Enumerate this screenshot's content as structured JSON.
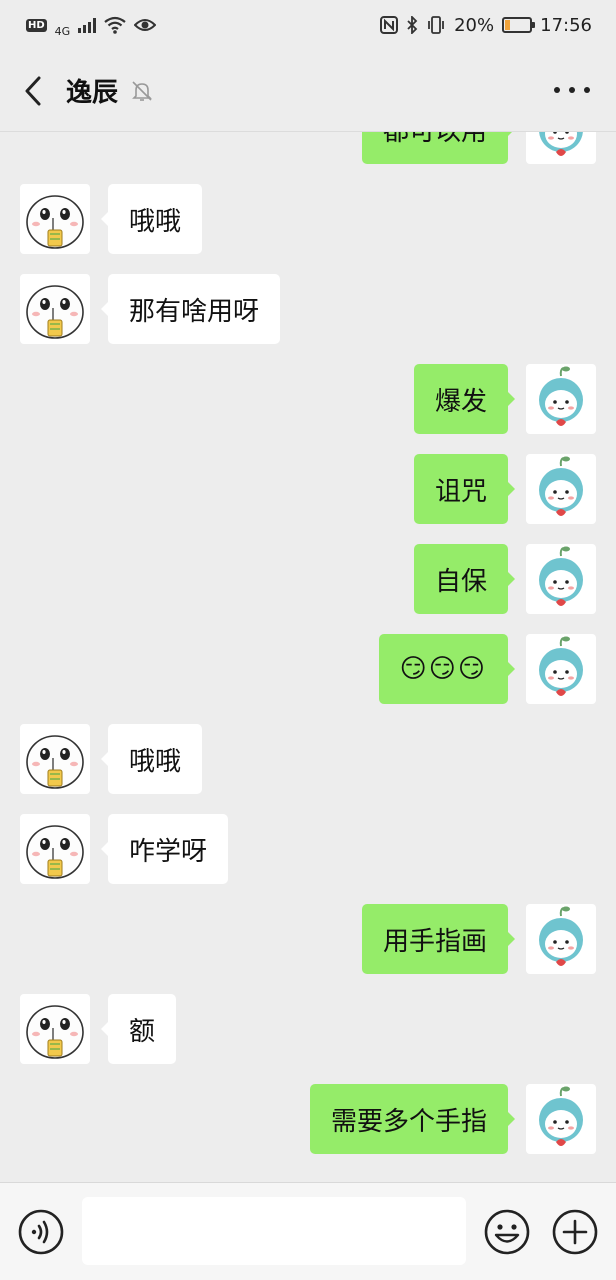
{
  "status_bar": {
    "network": "4G",
    "battery_percent": "20%",
    "battery_level": 0.2,
    "time": "17:56"
  },
  "header": {
    "title": "逸辰",
    "back_icon": "chevron-left-icon",
    "mute_icon": "bell-off-icon",
    "more_icon": "more-dots-icon"
  },
  "messages": [
    {
      "side": "right",
      "text": "都可以用",
      "avatar": "teal-cartoon-avatar"
    },
    {
      "side": "left",
      "text": "哦哦",
      "avatar": "white-cartoon-avatar"
    },
    {
      "side": "left",
      "text": "那有啥用呀",
      "avatar": "white-cartoon-avatar"
    },
    {
      "side": "right",
      "text": "爆发",
      "avatar": "teal-cartoon-avatar"
    },
    {
      "side": "right",
      "text": "诅咒",
      "avatar": "teal-cartoon-avatar"
    },
    {
      "side": "right",
      "text": "自保",
      "avatar": "teal-cartoon-avatar"
    },
    {
      "side": "right",
      "text": "",
      "emoji": [
        "😏",
        "😏",
        "😏"
      ],
      "avatar": "teal-cartoon-avatar"
    },
    {
      "side": "left",
      "text": "哦哦",
      "avatar": "white-cartoon-avatar"
    },
    {
      "side": "left",
      "text": "咋学呀",
      "avatar": "white-cartoon-avatar"
    },
    {
      "side": "right",
      "text": "用手指画",
      "avatar": "teal-cartoon-avatar"
    },
    {
      "side": "left",
      "text": "额",
      "avatar": "white-cartoon-avatar"
    },
    {
      "side": "right",
      "text": "需要多个手指",
      "avatar": "teal-cartoon-avatar"
    }
  ],
  "bottom_bar": {
    "voice_icon": "voice-input-icon",
    "input_value": "",
    "emoji_icon": "emoji-icon",
    "plus_icon": "plus-icon"
  },
  "colors": {
    "background": "#ededed",
    "bubble_sent": "#95ec69",
    "bubble_received": "#ffffff"
  }
}
